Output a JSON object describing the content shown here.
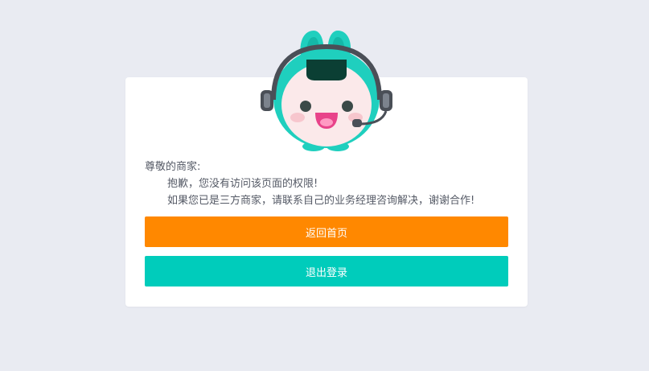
{
  "message": {
    "greeting": "尊敬的商家:",
    "line1": "抱歉，您没有访问该页面的权限!",
    "line2": "如果您已是三方商家，请联系自己的业务经理咨询解决，谢谢合作!"
  },
  "buttons": {
    "home_label": "返回首页",
    "logout_label": "退出登录"
  },
  "colors": {
    "background": "#e9ebf2",
    "card": "#ffffff",
    "home_button": "#ff8800",
    "logout_button": "#00ccbb",
    "mascot_body": "#1fcfbe",
    "text": "#555a66"
  },
  "icons": {
    "mascot": "customer-service-mascot-icon"
  }
}
